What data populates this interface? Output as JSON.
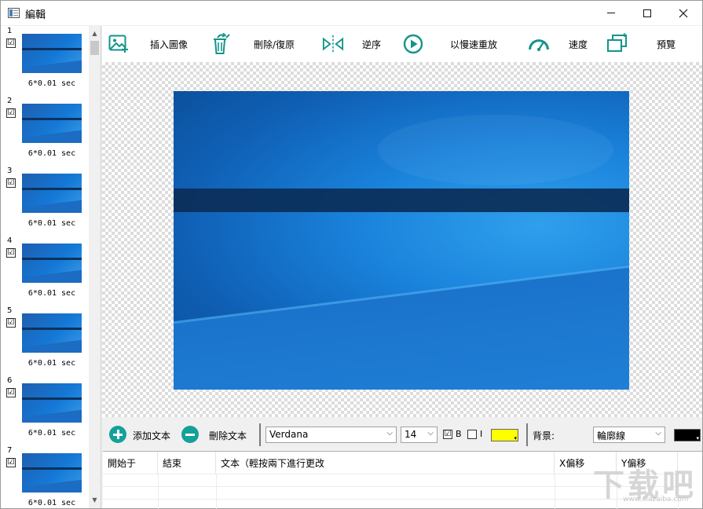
{
  "window": {
    "title": "編輯"
  },
  "frames": [
    {
      "number": "1",
      "caption": "6*0.01 sec",
      "checked": "☑"
    },
    {
      "number": "2",
      "caption": "6*0.01 sec",
      "checked": "☑"
    },
    {
      "number": "3",
      "caption": "6*0.01 sec",
      "checked": "☑"
    },
    {
      "number": "4",
      "caption": "6*0.01 sec",
      "checked": "☑"
    },
    {
      "number": "5",
      "caption": "6*0.01 sec",
      "checked": "☑"
    },
    {
      "number": "6",
      "caption": "6*0.01 sec",
      "checked": "☑"
    },
    {
      "number": "7",
      "caption": "6*0.01 sec",
      "checked": "☑"
    }
  ],
  "toolbar": {
    "insert_image": "插入圖像",
    "delete_restore": "刪除/復原",
    "reverse": "逆序",
    "slow_replay": "以慢速重放",
    "speed": "速度",
    "preview": "預覽"
  },
  "textbar": {
    "add_text": "添加文本",
    "delete_text": "刪除文本",
    "font": "Verdana",
    "font_size": "14",
    "bold_label": "B",
    "italic_label": "I",
    "bold_checked": "☑",
    "text_color": "#ffff00",
    "background_label": "背景:",
    "background_mode": "輪廓線",
    "outline_color": "#000000"
  },
  "table": {
    "columns": [
      "開始于",
      "結束",
      "文本（輕按兩下進行更改",
      "X偏移",
      "Y偏移"
    ]
  },
  "watermark": {
    "text": "下载吧",
    "url": "www.xiazaiba.com"
  },
  "colors": {
    "accent": "#14a19a",
    "icon_teal": "#13948c"
  }
}
